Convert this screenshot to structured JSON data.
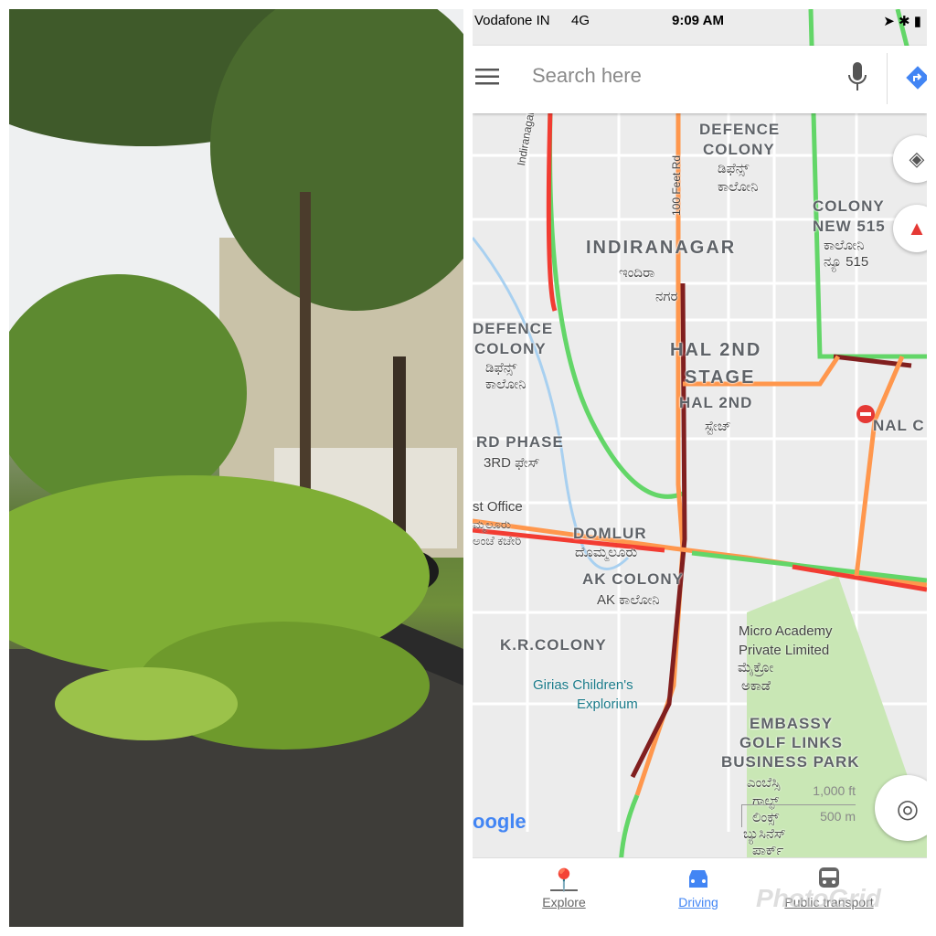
{
  "status_bar": {
    "carrier": "Vodafone IN",
    "network": "4G",
    "time": "9:09 AM"
  },
  "search": {
    "placeholder": "Search here",
    "menu_icon": "menu-icon",
    "mic_icon": "microphone-icon",
    "directions_icon": "directions-icon"
  },
  "map": {
    "labels": [
      {
        "text": "DEFENCE",
        "cls": "lbl"
      },
      {
        "text": "COLONY",
        "cls": "lbl"
      },
      {
        "text": "ಡಿಫೆನ್ಸ್",
        "cls": "lbl kn"
      },
      {
        "text": "ಕಾಲೋನಿ",
        "cls": "lbl kn"
      },
      {
        "text": "COLONY",
        "cls": "lbl"
      },
      {
        "text": "NEW 515",
        "cls": "lbl"
      },
      {
        "text": "ಕಾಲೋನಿ",
        "cls": "lbl kn"
      },
      {
        "text": "ನ್ಯೂ 515",
        "cls": "lbl kn"
      },
      {
        "text": "INDIRANAGAR",
        "cls": "lbl big"
      },
      {
        "text": "ಇಂದಿರಾ",
        "cls": "lbl kn"
      },
      {
        "text": "ನಗರ",
        "cls": "lbl kn"
      },
      {
        "text": "DEFENCE",
        "cls": "lbl"
      },
      {
        "text": "COLONY",
        "cls": "lbl"
      },
      {
        "text": "ಡಿಫೆನ್ಸ್",
        "cls": "lbl kn"
      },
      {
        "text": "ಕಾಲೋನಿ",
        "cls": "lbl kn"
      },
      {
        "text": "HAL 2ND",
        "cls": "lbl big"
      },
      {
        "text": "STAGE",
        "cls": "lbl big"
      },
      {
        "text": "HAL 2ND",
        "cls": "lbl"
      },
      {
        "text": "ಸ್ಟೇಜ್",
        "cls": "lbl kn"
      },
      {
        "text": "NAL C",
        "cls": "lbl"
      },
      {
        "text": "RD PHASE",
        "cls": "lbl"
      },
      {
        "text": "3RD ಫೇಸ್",
        "cls": "lbl kn"
      },
      {
        "text": "DOMLUR",
        "cls": "lbl"
      },
      {
        "text": "ದೊಮ್ಮಲೂರು",
        "cls": "lbl kn"
      },
      {
        "text": "AK COLONY",
        "cls": "lbl"
      },
      {
        "text": "AK ಕಾಲೋನಿ",
        "cls": "lbl kn"
      },
      {
        "text": "K.R.COLONY",
        "cls": "lbl"
      },
      {
        "text": "EMBASSY",
        "cls": "lbl"
      },
      {
        "text": "GOLF LINKS",
        "cls": "lbl"
      },
      {
        "text": "BUSINESS PARK",
        "cls": "lbl"
      },
      {
        "text": "ಎಂಬೆಸ್ಸಿ",
        "cls": "lbl kn"
      },
      {
        "text": "ಗಾಲ್ಫ್",
        "cls": "lbl kn"
      },
      {
        "text": "ಲಿಂಕ್ಸ್",
        "cls": "lbl kn"
      },
      {
        "text": "ಬ್ಯುಸಿನೆಸ್",
        "cls": "lbl kn"
      },
      {
        "text": "ಪಾರ್ಕ್",
        "cls": "lbl kn"
      },
      {
        "text": "Indiranagar Double",
        "cls": "lbl kn"
      },
      {
        "text": "100 Feet Rd",
        "cls": "lbl kn"
      }
    ],
    "pois": [
      "Micro Academy",
      "Private Limited",
      "ಮೈಕ್ರೋ",
      "ಅಕಾಡೆ",
      "Girias Children's",
      "Explorium",
      "st Office",
      "ಮ್ಮಲೂರು",
      "ಅಂಚೆ ಕಚೇರಿ"
    ],
    "scale": {
      "imperial": "1,000 ft",
      "metric": "500 m"
    },
    "logo": "Google",
    "layers_icon": "layers-icon",
    "compass_icon": "compass-icon",
    "location_icon": "my-location-icon",
    "traffic_colors": {
      "fast": "#63d668",
      "medium": "#ff974d",
      "slow": "#f23c32",
      "jam": "#811f1f"
    }
  },
  "bottom_nav": [
    {
      "label": "Explore",
      "icon": "explore-pin-icon",
      "active": false
    },
    {
      "label": "Driving",
      "icon": "car-icon",
      "active": true
    },
    {
      "label": "Public transport",
      "icon": "train-icon",
      "active": false
    }
  ],
  "watermark": "PhotoGrid"
}
